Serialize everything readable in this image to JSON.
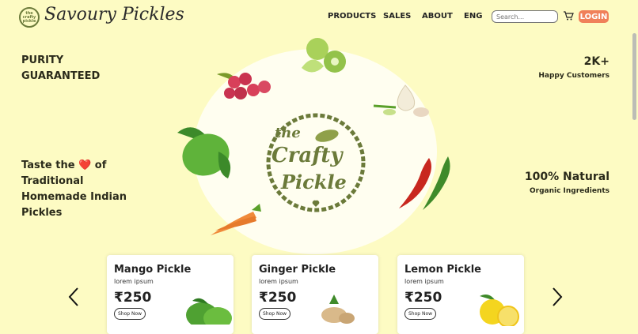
{
  "header": {
    "brand": "Savoury Pickles",
    "nav": [
      "PRODUCTS",
      "SALES",
      "ABOUT",
      "ENG"
    ],
    "search_placeholder": "Search...",
    "login_label": "LOGIN"
  },
  "hero": {
    "left_top": [
      "PURITY",
      "GUARANTEED"
    ],
    "tagline_before_heart": "Taste the",
    "tagline_after_heart": "of",
    "tagline_rest": "Traditional Homemade Indian Pickles",
    "stat1_value": "2K+",
    "stat1_label": "Happy Customers",
    "stat2_value": "100% Natural",
    "stat2_label": "Organic Ingredients",
    "logo_line1": "the",
    "logo_line2": "Crafty",
    "logo_line3": "Pickle"
  },
  "products": [
    {
      "name": "Mango Pickle",
      "desc": "lorem ipsum",
      "price": "₹250",
      "button": "Shop Now"
    },
    {
      "name": "Ginger Pickle",
      "desc": "lorem ipsum",
      "price": "₹250",
      "button": "Shop Now"
    },
    {
      "name": "Lemon Pickle",
      "desc": "lorem ipsum",
      "price": "₹250",
      "button": "Shop Now"
    }
  ],
  "colors": {
    "background": "#fdfbc3",
    "accent": "#f0805a",
    "logo_green": "#6b7a3a"
  }
}
